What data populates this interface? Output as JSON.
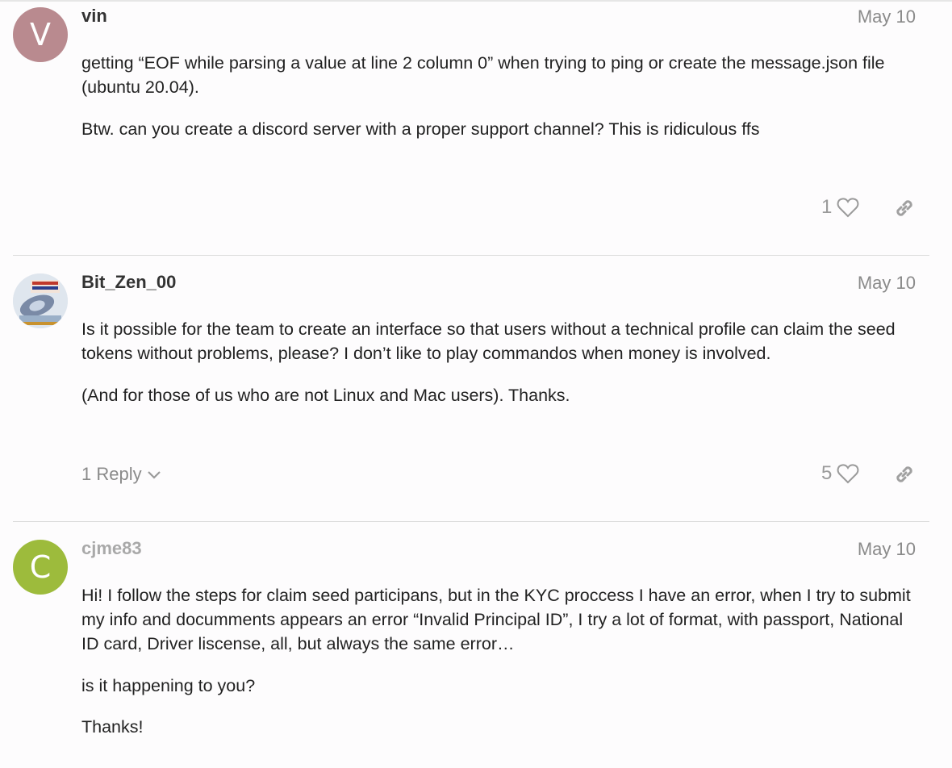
{
  "posts": [
    {
      "username": "vin",
      "avatar_letter": "V",
      "avatar_color": "#b98a8f",
      "date": "May 10",
      "paragraphs": [
        "getting “EOF while parsing a value at line 2 column 0” when trying to ping or create the message.json file (ubuntu 20.04).",
        "Btw. can you create a discord server with a proper support channel? This is ridiculous ffs"
      ],
      "likes": "1"
    },
    {
      "username": "Bit_Zen_00",
      "avatar_image": "technical-logo-avatar",
      "date": "May 10",
      "paragraphs": [
        "Is it possible for the team to create an interface so that users without a technical profile can claim the seed tokens without problems, please? I don’t like to play commandos when money is involved.",
        "(And for those of us who are not Linux and Mac users). Thanks."
      ],
      "reply_label": "1 Reply",
      "likes": "5"
    },
    {
      "username": "cjme83",
      "avatar_letter": "C",
      "avatar_color": "#9dbb3c",
      "date": "May 10",
      "paragraphs": [
        "Hi! I follow the steps for claim seed participans, but in the KYC proccess I have an error, when I try to submit my info and documments appears an error “Invalid Principal ID”, I try a lot of format, with passport, National ID card, Driver liscense, all, but always the same error…",
        "is it happening to you?",
        "Thanks!"
      ]
    }
  ],
  "icons": {
    "like": "heart-icon",
    "share": "link-icon",
    "expand": "chevron-down-icon"
  }
}
